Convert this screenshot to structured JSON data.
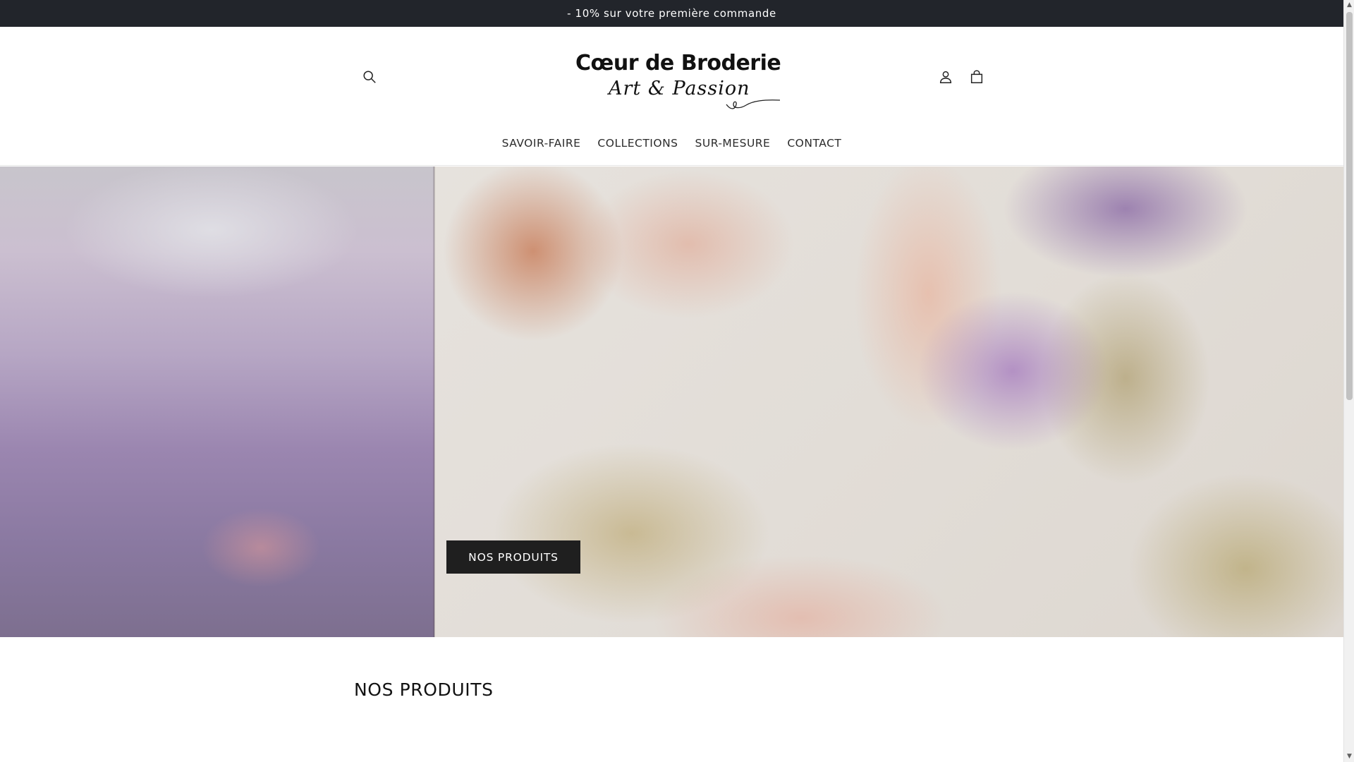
{
  "announcement": {
    "text": "- 10% sur votre première commande"
  },
  "header": {
    "logo": {
      "main": "Cœur de Broderie",
      "script": "Art & Passion"
    },
    "icons": {
      "search": "search-icon",
      "account": "user-icon",
      "cart": "shopping-bag-icon"
    }
  },
  "nav": {
    "items": [
      {
        "label": "SAVOIR-FAIRE"
      },
      {
        "label": "COLLECTIONS"
      },
      {
        "label": "SUR-MESURE"
      },
      {
        "label": "CONTACT"
      }
    ]
  },
  "hero": {
    "button_label": "NOS PRODUITS"
  },
  "section": {
    "title": "NOS PRODUITS"
  },
  "colors": {
    "announcement_bg": "#22252b",
    "button_bg": "#1f1f1f",
    "text": "#121212"
  }
}
